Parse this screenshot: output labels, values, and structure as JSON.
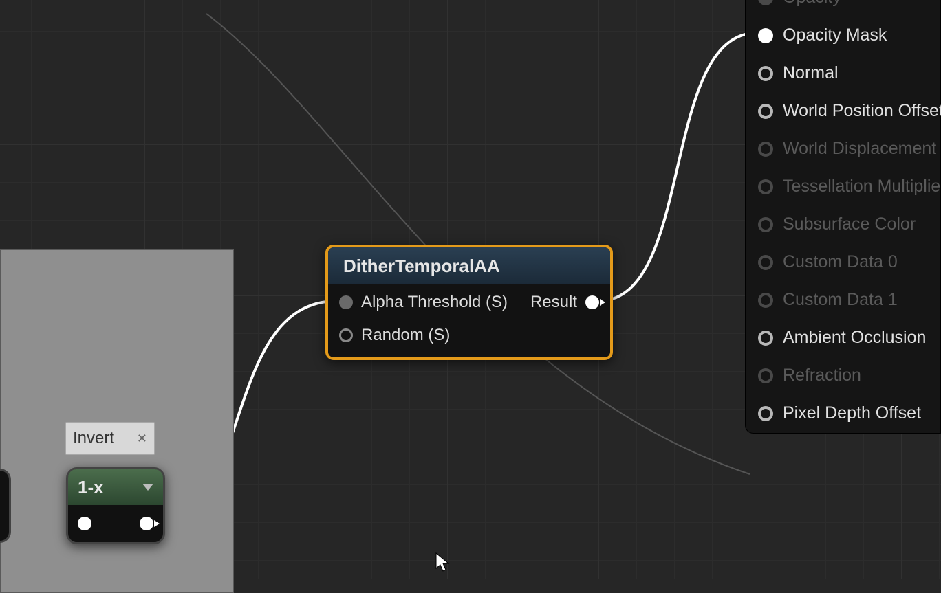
{
  "dither_node": {
    "title": "DitherTemporalAA",
    "inputs": [
      {
        "label": "Alpha Threshold (S)",
        "connected": true
      },
      {
        "label": "Random (S)",
        "connected": false
      }
    ],
    "outputs": [
      {
        "label": "Result"
      }
    ]
  },
  "invert_comment": {
    "label": "Invert"
  },
  "oneminus_node": {
    "title": "1-x"
  },
  "material_output": {
    "pins": [
      {
        "label": "Opacity",
        "enabled": false,
        "connected": false
      },
      {
        "label": "Opacity Mask",
        "enabled": true,
        "connected": true
      },
      {
        "label": "Normal",
        "enabled": true,
        "connected": false
      },
      {
        "label": "World Position Offset",
        "enabled": true,
        "connected": false
      },
      {
        "label": "World Displacement",
        "enabled": false,
        "connected": false
      },
      {
        "label": "Tessellation Multiplier",
        "enabled": false,
        "connected": false
      },
      {
        "label": "Subsurface Color",
        "enabled": false,
        "connected": false
      },
      {
        "label": "Custom Data 0",
        "enabled": false,
        "connected": false
      },
      {
        "label": "Custom Data 1",
        "enabled": false,
        "connected": false
      },
      {
        "label": "Ambient Occlusion",
        "enabled": true,
        "connected": false
      },
      {
        "label": "Refraction",
        "enabled": false,
        "connected": false
      },
      {
        "label": "Pixel Depth Offset",
        "enabled": true,
        "connected": false
      }
    ]
  }
}
